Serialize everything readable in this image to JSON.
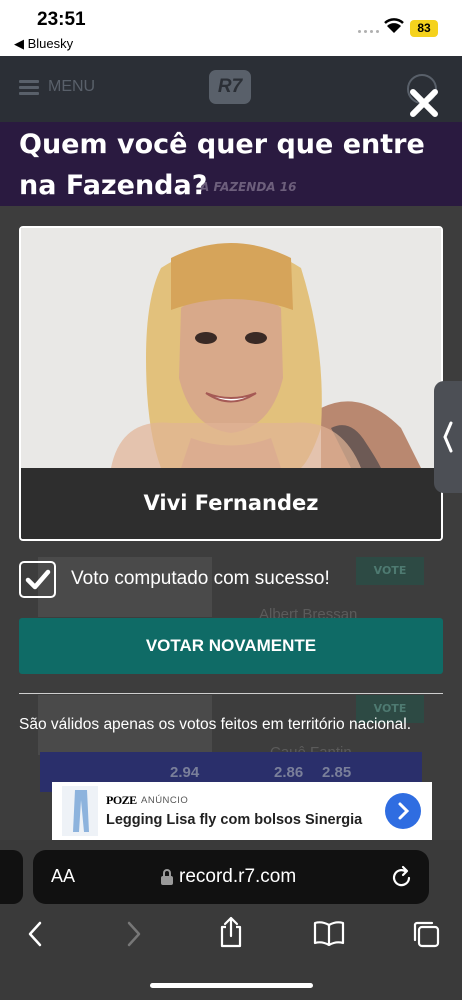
{
  "status_bar": {
    "time": "23:51",
    "back_app": "◀ Bluesky",
    "battery": "83"
  },
  "site_header": {
    "menu_label": "MENU",
    "logo": "R7"
  },
  "banner": {
    "text": "A FAZENDA 16"
  },
  "modal": {
    "title": "Quem você quer que entre na Fazenda?",
    "candidate_name": "Vivi Fernandez",
    "success_message": "Voto computado com sucesso!",
    "vote_again_label": "VOTAR NOVAMENTE",
    "note": "São válidos apenas os votos feitos em território nacional."
  },
  "background_items": [
    {
      "name": "Albert Bressan",
      "vote_label": "VOTE"
    },
    {
      "name": "Cauê Fantin",
      "vote_label": "VOTE"
    }
  ],
  "odds": [
    "2.94",
    "2.86",
    "2.85"
  ],
  "ad": {
    "brand": "POZE",
    "tag": "ANÚNCIO",
    "title": "Legging Lisa fly com bolsos Sinergia"
  },
  "browser": {
    "text_size_label": "AA",
    "url": "record.r7.com"
  },
  "colors": {
    "vote_again": "#0f6b66",
    "ad_arrow": "#2f6de1",
    "battery": "#f5d21d"
  }
}
